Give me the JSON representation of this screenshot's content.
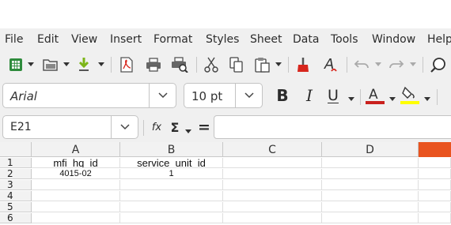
{
  "menubar": {
    "items": [
      {
        "label": "File",
        "name": "menu-file"
      },
      {
        "label": "Edit",
        "name": "menu-edit"
      },
      {
        "label": "View",
        "name": "menu-view"
      },
      {
        "label": "Insert",
        "name": "menu-insert"
      },
      {
        "label": "Format",
        "name": "menu-format"
      },
      {
        "label": "Styles",
        "name": "menu-styles"
      },
      {
        "label": "Sheet",
        "name": "menu-sheet"
      },
      {
        "label": "Data",
        "name": "menu-data"
      },
      {
        "label": "Tools",
        "name": "menu-tools"
      },
      {
        "label": "Window",
        "name": "menu-window"
      },
      {
        "label": "Help",
        "name": "menu-help"
      }
    ]
  },
  "toolbar": {
    "icons": [
      "new-spreadsheet-icon",
      "open-folder-icon",
      "save-icon",
      "export-pdf-icon",
      "print-icon",
      "print-preview-icon",
      "cut-icon",
      "copy-icon",
      "paste-icon",
      "clone-formatting-icon",
      "clear-formatting-icon",
      "undo-icon",
      "redo-icon",
      "find-replace-icon"
    ],
    "accent_colors": {
      "new": "#2e8b3c",
      "save": "#7cb518",
      "pdf": "#d7261d",
      "clear_format": "#d7261d"
    }
  },
  "format_bar": {
    "font_name": "Arial",
    "font_size": "10 pt",
    "bold_label": "B",
    "italic_label": "I",
    "underline_label": "U",
    "font_color": "#c9211e",
    "highlight_color": "#ffff00"
  },
  "formula_bar": {
    "name_box": "E21",
    "fx_label": "fx",
    "sum_label": "Σ",
    "equals_label": "=",
    "formula_value": ""
  },
  "sheet": {
    "columns": [
      "A",
      "B",
      "C",
      "D",
      ""
    ],
    "selected_column_color": "#e9541f",
    "rows": [
      "1",
      "2",
      "3",
      "4",
      "5",
      "6"
    ],
    "cells": {
      "A1": "mfi_hq_id",
      "B1": "service_unit_id",
      "A2": "4015-02",
      "B2": "1"
    }
  }
}
